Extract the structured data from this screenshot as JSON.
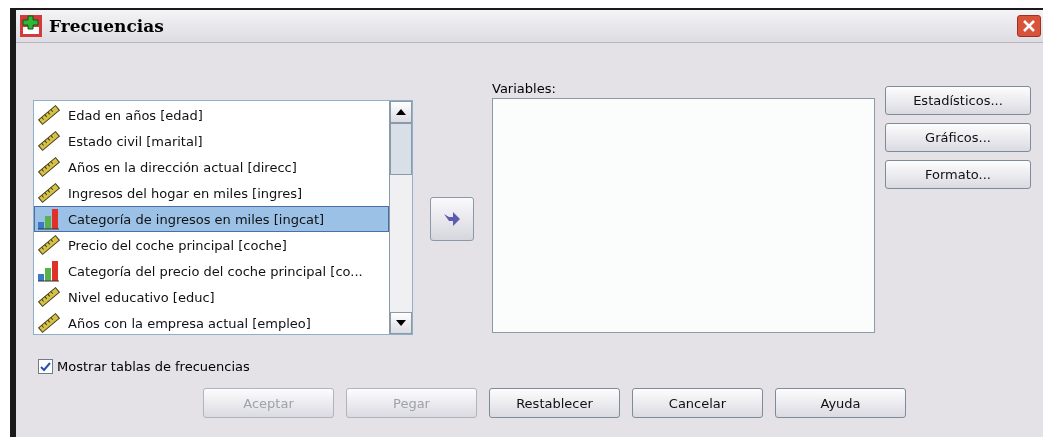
{
  "window": {
    "title": "Frecuencias"
  },
  "source_list": {
    "items": [
      {
        "label": "Edad en años [edad]",
        "kind": "scale",
        "selected": false
      },
      {
        "label": "Estado civil [marital]",
        "kind": "scale",
        "selected": false
      },
      {
        "label": "Años en la dirección actual [direcc]",
        "kind": "scale",
        "selected": false
      },
      {
        "label": "Ingresos del hogar en miles [ingres]",
        "kind": "scale",
        "selected": false
      },
      {
        "label": "Categoría de ingresos en miles [ingcat]",
        "kind": "ordinal",
        "selected": true
      },
      {
        "label": "Precio del coche principal [coche]",
        "kind": "scale",
        "selected": false
      },
      {
        "label": "Categoría del precio del coche principal [co...",
        "kind": "ordinal",
        "selected": false
      },
      {
        "label": "Nivel educativo [educ]",
        "kind": "scale",
        "selected": false
      },
      {
        "label": "Años con la empresa actual [empleo]",
        "kind": "scale",
        "selected": false
      }
    ]
  },
  "variables": {
    "label": "Variables:"
  },
  "side_buttons": [
    "Estadísticos...",
    "Gráficos...",
    "Formato..."
  ],
  "show_tables": {
    "label": "Mostrar tablas de frecuencias",
    "checked": true
  },
  "buttons": [
    {
      "label": "Aceptar",
      "disabled": true
    },
    {
      "label": "Pegar",
      "disabled": true
    },
    {
      "label": "Restablecer",
      "disabled": false
    },
    {
      "label": "Cancelar",
      "disabled": false
    },
    {
      "label": "Ayuda",
      "disabled": false
    }
  ]
}
